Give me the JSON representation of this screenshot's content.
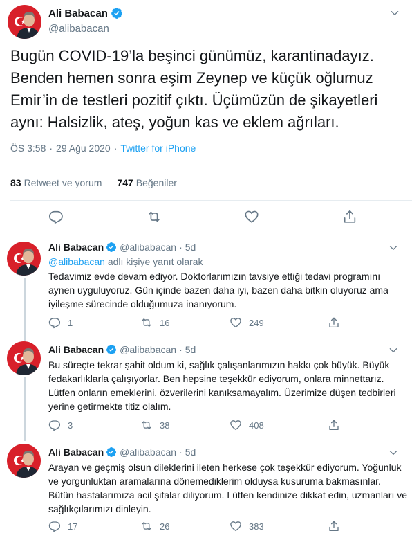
{
  "main_tweet": {
    "author_name": "Ali Babacan",
    "handle": "@alibabacan",
    "text": "Bugün COVID-19’la beşinci günümüz, karantinadayız. Benden hemen sonra eşim Zeynep ve küçük oğlumuz Emir’in de testleri pozitif çıktı. Üçümüzün de şikayetleri aynı: Halsizlik, ateş, yoğun kas ve eklem ağrıları.",
    "time": "ÖS 3:58",
    "separator": "·",
    "date": "29 Ağu 2020",
    "source": "Twitter for iPhone",
    "retweets_count": "83",
    "retweets_label": "Retweet ve yorum",
    "likes_count": "747",
    "likes_label": "Beğeniler"
  },
  "replies": [
    {
      "author_name": "Ali Babacan",
      "handle": "@alibabacan",
      "dot": "·",
      "time": "5d",
      "replying_mention": "@alibabacan",
      "replying_suffix": " adlı kişiye yanıt olarak",
      "text": "Tedavimiz evde devam ediyor. Doktorlarımızın tavsiye ettiği tedavi programını aynen uyguluyoruz. Gün içinde bazen daha iyi, bazen daha bitkin oluyoruz ama iyileşme sürecinde olduğumuza inanıyorum.",
      "replies": "1",
      "retweets": "16",
      "likes": "249"
    },
    {
      "author_name": "Ali Babacan",
      "handle": "@alibabacan",
      "dot": "·",
      "time": "5d",
      "text": "Bu süreçte tekrar şahit oldum ki, sağlık çalışanlarımızın hakkı çok büyük. Büyük fedakarlıklarla çalışıyorlar. Ben hepsine teşekkür ediyorum, onlara minnettarız. Lütfen onların emeklerini, özverilerini kanıksamayalım. Üzerimize düşen tedbirleri yerine getirmekte titiz olalım.",
      "replies": "3",
      "retweets": "38",
      "likes": "408"
    },
    {
      "author_name": "Ali Babacan",
      "handle": "@alibabacan",
      "dot": "·",
      "time": "5d",
      "text": "Arayan ve geçmiş olsun dileklerini ileten herkese çok teşekkür ediyorum. Yoğunluk ve yorgunluktan aramalarına dönemediklerim olduysa kusuruma bakmasınlar. Bütün hastalarımıza acil şifalar diliyorum. Lütfen kendinize dikkat edin, uzmanları ve sağlıkçılarımızı dinleyin.",
      "replies": "17",
      "retweets": "26",
      "likes": "383"
    }
  ],
  "colors": {
    "text": "#14171a",
    "secondary": "#657786",
    "accent": "#1da1f2",
    "divider": "#e6ecf0",
    "verified": "#1da1f2"
  }
}
